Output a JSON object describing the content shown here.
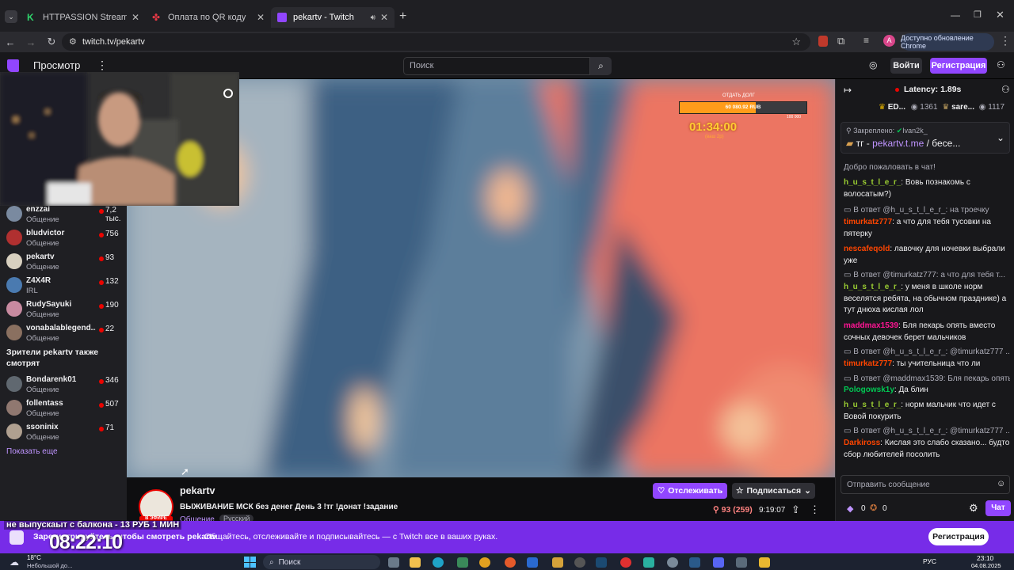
{
  "browser": {
    "tabs": [
      {
        "title": "HTTPASSION Stream - Watch L",
        "color": "#2fd36b"
      },
      {
        "title": "Оплата по QR коду",
        "color": "#e63946"
      },
      {
        "title": "pekartv - Twitch",
        "color": "#9146ff"
      }
    ],
    "url": "twitch.tv/pekartv",
    "update_label": "Доступно обновление Chrome"
  },
  "twitch_header": {
    "browse": "Просмотр",
    "search_placeholder": "Поиск",
    "login": "Войти",
    "signup": "Регистрация"
  },
  "sidebar": {
    "channels": [
      {
        "name": "enzzai",
        "category": "Общение",
        "viewers": "7,2 тыс.",
        "color": "#7a8aa0"
      },
      {
        "name": "bludvictor",
        "category": "Общение",
        "viewers": "756",
        "color": "#b03030"
      },
      {
        "name": "pekartv",
        "category": "Общение",
        "viewers": "93",
        "color": "#d8d0c0"
      },
      {
        "name": "Z4X4R",
        "category": "IRL",
        "viewers": "132",
        "color": "#4a7ab0"
      },
      {
        "name": "RudySayuki",
        "category": "Общение",
        "viewers": "190",
        "color": "#c88aa0"
      },
      {
        "name": "vonabalablegend...",
        "category": "Общение",
        "viewers": "22",
        "color": "#8a7060"
      }
    ],
    "also_watch_title": "Зрители pekartv также смотрят",
    "also_watch": [
      {
        "name": "Bondarenk01",
        "category": "Общение",
        "viewers": "346",
        "color": "#606870"
      },
      {
        "name": "follentass",
        "category": "Общение",
        "viewers": "507",
        "color": "#907870"
      },
      {
        "name": "ssoninix",
        "category": "Общение",
        "viewers": "71",
        "color": "#b0a090"
      }
    ],
    "show_more": "Показать еще"
  },
  "overlay": {
    "debt_label": "ОТДАТЬ ДОЛГ",
    "debt_amount": "60 080.92 RUB",
    "debt_goal": "100 000",
    "debt_progress": 0.6,
    "timer": "01:34:00",
    "timer_sub": "(ваш 2р)"
  },
  "stream_info": {
    "channel": "pekartv",
    "title": "ВЫЖИВАНИЕ МСК без денег День 3 !тг !донат !задание",
    "category": "Общение",
    "tag": "Русский",
    "viewers": "93 (259)",
    "uptime": "9:19:07",
    "follow": "Отслеживать",
    "subscribe": "Подписаться",
    "avatar_label": "В ЭФИРЕ"
  },
  "chat": {
    "latency": "Latency: 1.89s",
    "leaders": [
      {
        "name": "ED...",
        "count": "1361"
      },
      {
        "name": "sare...",
        "count": "1117"
      }
    ],
    "pinned_by": "Закреплено:",
    "pinned_user": "Ivan2k_",
    "pinned_prefix": "тг - ",
    "pinned_link": "pekartv.t.me",
    "pinned_suffix": " / бесе...",
    "welcome": "Добро пожаловать в чат!",
    "messages": [
      {
        "reply": "",
        "user": "h_u_s_t_l_e_r_",
        "color": "#9acd32",
        "text": ": Вовь познакомь с волосатым?)"
      },
      {
        "reply": "В ответ @h_u_s_t_l_e_r_: на троечку",
        "user": "timurkatz777",
        "color": "#ff4500",
        "text": ": а что для тебя тусовки на пятерку"
      },
      {
        "reply": "",
        "user": "nescafeqold",
        "color": "#ff4500",
        "text": ": лавочку для ночевки выбрали уже"
      },
      {
        "reply": "В ответ @timurkatz777: а что для тебя т...",
        "user": "h_u_s_t_l_e_r_",
        "color": "#9acd32",
        "text": ": у меня в школе норм веселятся ребята, на обычном празднике) а тут днюха кислая лол"
      },
      {
        "reply": "",
        "user": "maddmax1539",
        "color": "#ff1493",
        "text": ": Бля пекарь опять вместо сочных девочек берет мальчиков"
      },
      {
        "reply": "В ответ @h_u_s_t_l_e_r_: @timurkatz777 ...",
        "user": "timurkatz777",
        "color": "#ff4500",
        "text": ": ты учительница что ли"
      },
      {
        "reply": "В ответ @maddmax1539: Бля пекарь опять...",
        "user": "Pologowsk1y",
        "color": "#00c853",
        "text": ": Да блин"
      },
      {
        "reply": "",
        "user": "h_u_s_t_l_e_r_",
        "color": "#9acd32",
        "text": ": норм мальчик что идет с Вовой покурить"
      },
      {
        "reply": "В ответ @h_u_s_t_l_e_r_: @timurkatz777 ...",
        "user": "Darkiross",
        "color": "#ff4500",
        "text": ": Кислая это слабо сказано... будто сбор любителей посолить"
      }
    ],
    "input_placeholder": "Отправить сообщение",
    "points_a": "0",
    "points_b": "0",
    "send": "Чат"
  },
  "banner": {
    "ticker": "не выпускаыт с балкона - 13 РУБ 1 МИН",
    "clock": "08:22:10",
    "text": "Зарегистрируйтесь, чтобы смотреть pekartv",
    "subtext": "Общайтесь, отслеживайте и подписывайтесь — с Twitch все в ваших руках.",
    "signup": "Регистрация"
  },
  "taskbar": {
    "weather_temp": "18°C",
    "weather_desc": "Небольшой до...",
    "search": "Поиск",
    "lang": "РУС",
    "time": "23:10",
    "date": "04.08.2025"
  }
}
